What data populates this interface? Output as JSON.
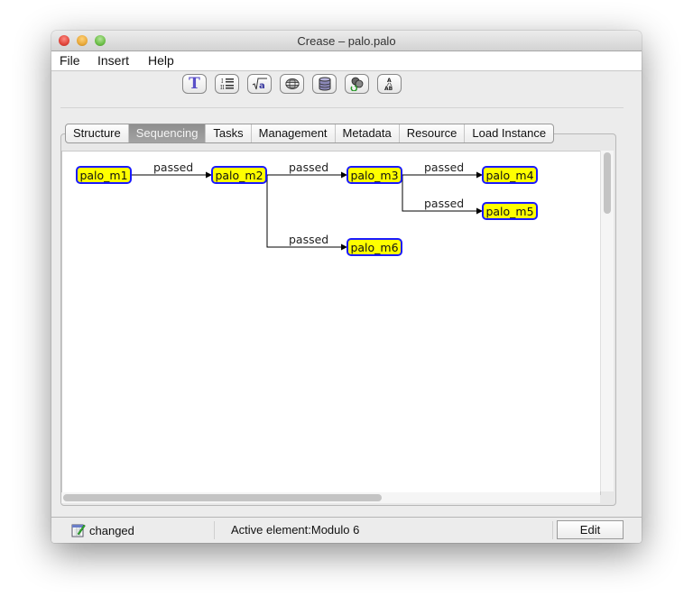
{
  "window": {
    "title": "Crease – palo.palo"
  },
  "menu": {
    "items": [
      "File",
      "Insert",
      "Help"
    ]
  },
  "toolbar": {
    "buttons": [
      {
        "icon": "text-T-icon"
      },
      {
        "icon": "numbered-list-icon"
      },
      {
        "icon": "formula-sqrt-icon"
      },
      {
        "icon": "link-icon"
      },
      {
        "icon": "database-icon"
      },
      {
        "icon": "resource-refresh-icon"
      },
      {
        "icon": "sequence-ab-icon"
      }
    ]
  },
  "tabs": [
    "Structure",
    "Sequencing",
    "Tasks",
    "Management",
    "Metadata",
    "Resource",
    "Load Instance"
  ],
  "active_tab": "Sequencing",
  "diagram": {
    "nodes": [
      {
        "id": "m1",
        "label": "palo_m1"
      },
      {
        "id": "m2",
        "label": "palo_m2"
      },
      {
        "id": "m3",
        "label": "palo_m3"
      },
      {
        "id": "m4",
        "label": "palo_m4"
      },
      {
        "id": "m5",
        "label": "palo_m5"
      },
      {
        "id": "m6",
        "label": "palo_m6"
      }
    ],
    "edges": [
      {
        "from": "m1",
        "to": "m2",
        "label": "passed"
      },
      {
        "from": "m2",
        "to": "m3",
        "label": "passed"
      },
      {
        "from": "m3",
        "to": "m4",
        "label": "passed"
      },
      {
        "from": "m3",
        "to": "m5",
        "label": "passed"
      },
      {
        "from": "m2",
        "to": "m6",
        "label": "passed"
      }
    ],
    "colors": {
      "node_fill": "#ffff00",
      "node_border": "#1a1aff"
    }
  },
  "status": {
    "changed_label": "changed",
    "active_element": "Active element:Modulo 6",
    "edit_label": "Edit"
  }
}
